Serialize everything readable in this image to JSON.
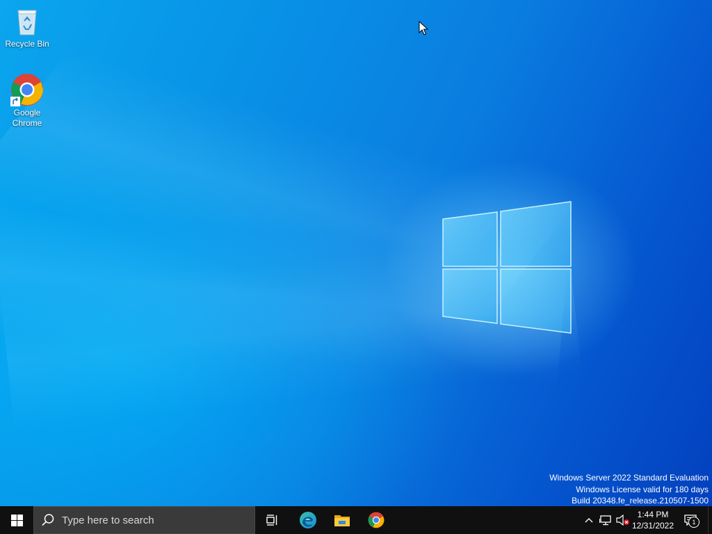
{
  "desktop": {
    "icons": [
      {
        "label": "Recycle Bin",
        "icon": "recycle-bin-icon"
      },
      {
        "label": "Google\nChrome",
        "icon": "chrome-icon"
      }
    ],
    "watermark": {
      "line1": "Windows Server 2022 Standard Evaluation",
      "line2": "Windows License valid for 180 days",
      "line3": "Build 20348.fe_release.210507-1500"
    }
  },
  "taskbar": {
    "start_icon": "windows-logo-icon",
    "search": {
      "placeholder": "Type here to search",
      "icon": "search-icon"
    },
    "pinned": [
      {
        "name": "Task View",
        "icon": "task-view-icon"
      },
      {
        "name": "Microsoft Edge",
        "icon": "edge-icon"
      },
      {
        "name": "File Explorer",
        "icon": "folder-icon"
      },
      {
        "name": "Google Chrome",
        "icon": "chrome-icon"
      }
    ],
    "tray": {
      "chevron_icon": "chevron-up-icon",
      "network_icon": "network-icon",
      "volume_icon": "volume-muted-icon",
      "time": "1:44 PM",
      "date": "12/31/2022",
      "notifications_count": "1"
    }
  },
  "colors": {
    "wallpaper_primary": "#0a86e4",
    "taskbar_bg": "#101010",
    "search_bg": "#3a3a3a"
  }
}
